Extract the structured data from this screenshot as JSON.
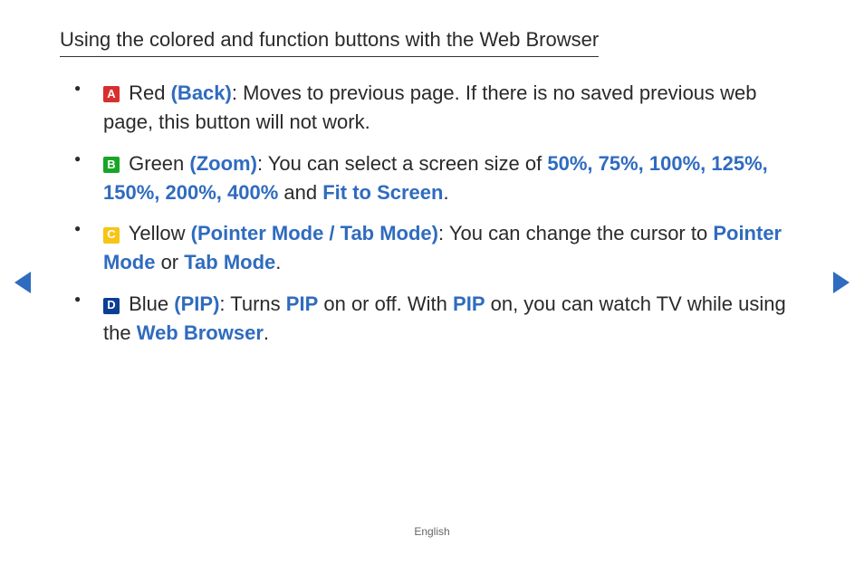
{
  "title": "Using the colored and function buttons with the Web Browser",
  "items": [
    {
      "badge": "A",
      "badgeColor": "red",
      "colorName": "Red",
      "label": "(Back)",
      "preText": ": Moves to previous page. If there is no saved previous web page, this button will not work."
    },
    {
      "badge": "B",
      "badgeColor": "green",
      "colorName": "Green",
      "label": "(Zoom)",
      "preText": ": You can select a screen size of ",
      "hl1": "50%, 75%, 100%, 125%, 150%, 200%, 400%",
      "mid1": " and ",
      "hl2": "Fit to Screen",
      "tail": "."
    },
    {
      "badge": "C",
      "badgeColor": "yellow",
      "colorName": "Yellow",
      "label": "(Pointer Mode / Tab Mode)",
      "preText": ": You can change the cursor to ",
      "hl1": "Pointer Mode",
      "mid1": " or ",
      "hl2": "Tab Mode",
      "tail": "."
    },
    {
      "badge": "D",
      "badgeColor": "blue",
      "colorName": "Blue",
      "label": "(PIP)",
      "preText": ": Turns ",
      "hl1": "PIP",
      "mid1": " on or off. With ",
      "hl2": "PIP",
      "mid2": " on, you can watch TV while using the ",
      "hl3": "Web Browser",
      "tail": "."
    }
  ],
  "footer": "English"
}
